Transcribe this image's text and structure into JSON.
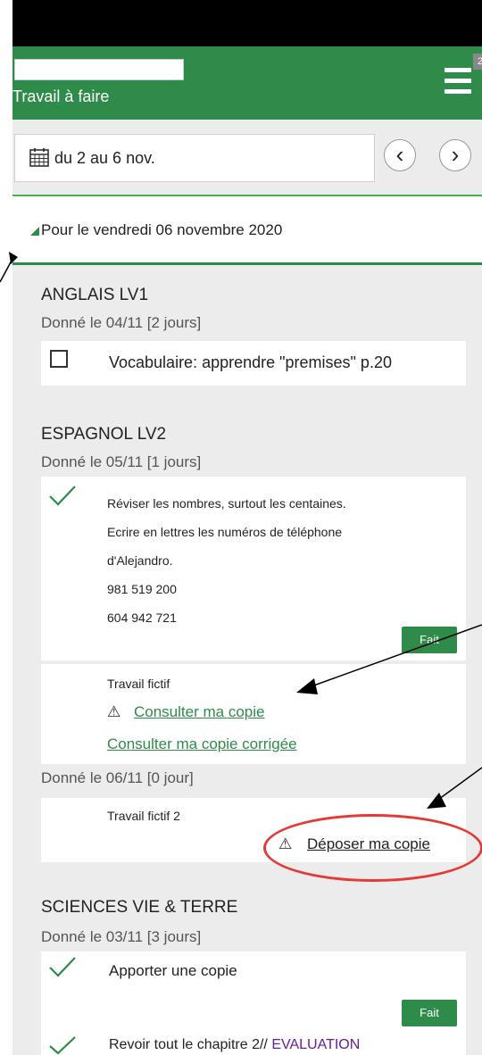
{
  "header": {
    "title": "Travail à faire",
    "badge": "2"
  },
  "date_range": {
    "label": "du 2 au 6 nov.",
    "prev": "‹",
    "next": "›"
  },
  "day": {
    "label": "Pour le vendredi 06 novembre 2020"
  },
  "subjects": [
    {
      "name": "ANGLAIS LV1",
      "given": "Donné le 04/11 [2 jours]",
      "task": "Vocabulaire: apprendre \"premises\" p.20"
    },
    {
      "name": "ESPAGNOL LV2",
      "given": "Donné le 05/11 [1 jours]",
      "task_lines": [
        "Réviser les nombres, surtout les centaines.",
        "Ecrire en lettres les numéros de téléphone",
        "d'Alejandro.",
        "981 519 200",
        "604 942 721"
      ],
      "fait": "Fait",
      "fictif_title": "Travail fictif",
      "warn_symbol": "⚠",
      "consult_link": "Consulter ma copie",
      "consult_corrected_link": "Consulter ma copie corrigée",
      "given2": "Donné le 06/11 [0 jour]",
      "fictif2_title": "Travail fictif 2",
      "deposit_link": "Déposer ma copie"
    },
    {
      "name": "SCIENCES VIE & TERRE",
      "given": "Donné le 03/11 [3 jours]",
      "task1": "Apporter une copie",
      "fait": "Fait",
      "task2_prefix": "Revoir tout le chapitre 2// ",
      "task2_highlight": "EVALUATION"
    }
  ],
  "colors": {
    "primary": "#2e8b4a",
    "annotation": "#e53935",
    "evaluation": "#6a1b9a"
  }
}
